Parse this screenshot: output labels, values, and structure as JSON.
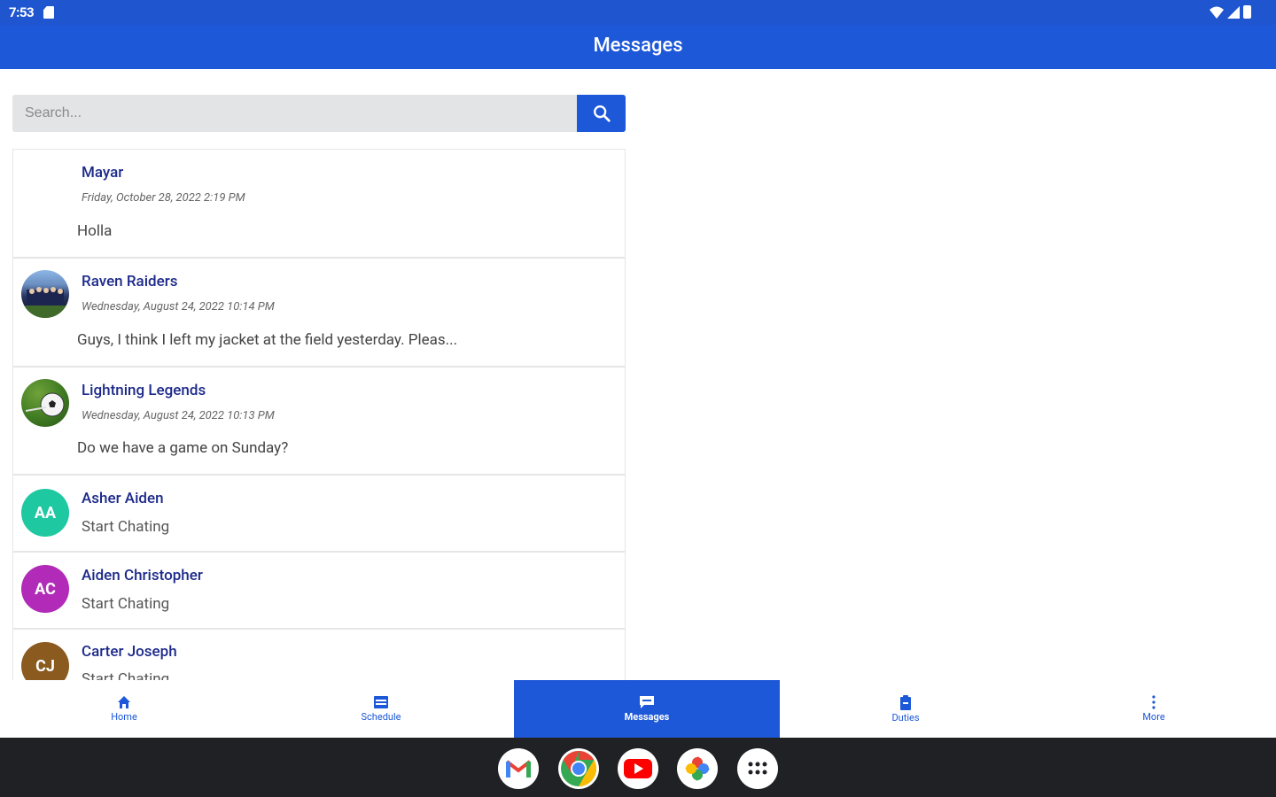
{
  "status_bar": {
    "time": "7:53"
  },
  "header": {
    "title": "Messages"
  },
  "search": {
    "placeholder": "Search..."
  },
  "conversations": [
    {
      "name": "Mayar",
      "date": "Friday, October 28, 2022 2:19 PM",
      "message": "Holla"
    },
    {
      "name": "Raven Raiders",
      "date": "Wednesday, August 24, 2022 10:14 PM",
      "message": "Guys, I think I left my jacket at the field yesterday. Pleas..."
    },
    {
      "name": "Lightning Legends",
      "date": "Wednesday, August 24, 2022 10:13 PM",
      "message": "Do we have a game on Sunday?"
    },
    {
      "name": "Asher Aiden",
      "initials": "AA",
      "color": "#1ec8a0",
      "message": "Start Chating"
    },
    {
      "name": "Aiden Christopher",
      "initials": "AC",
      "color": "#b12ab8",
      "message": "Start Chating"
    },
    {
      "name": "Carter Joseph",
      "initials": "CJ",
      "color": "#8a5a1e",
      "message": "Start Chating"
    }
  ],
  "bottom_nav": {
    "items": [
      {
        "label": "Home",
        "icon": "home-icon"
      },
      {
        "label": "Schedule",
        "icon": "schedule-icon"
      },
      {
        "label": "Messages",
        "icon": "chat-icon",
        "active": true
      },
      {
        "label": "Duties",
        "icon": "clipboard-icon"
      },
      {
        "label": "More",
        "icon": "more-vert-icon"
      }
    ]
  },
  "dock": {
    "apps": [
      "Gmail",
      "Chrome",
      "YouTube",
      "Photos",
      "App drawer"
    ]
  },
  "colors": {
    "primary": "#1d58d8",
    "name_text": "#1d2a8a",
    "dock_bg": "#202124"
  }
}
